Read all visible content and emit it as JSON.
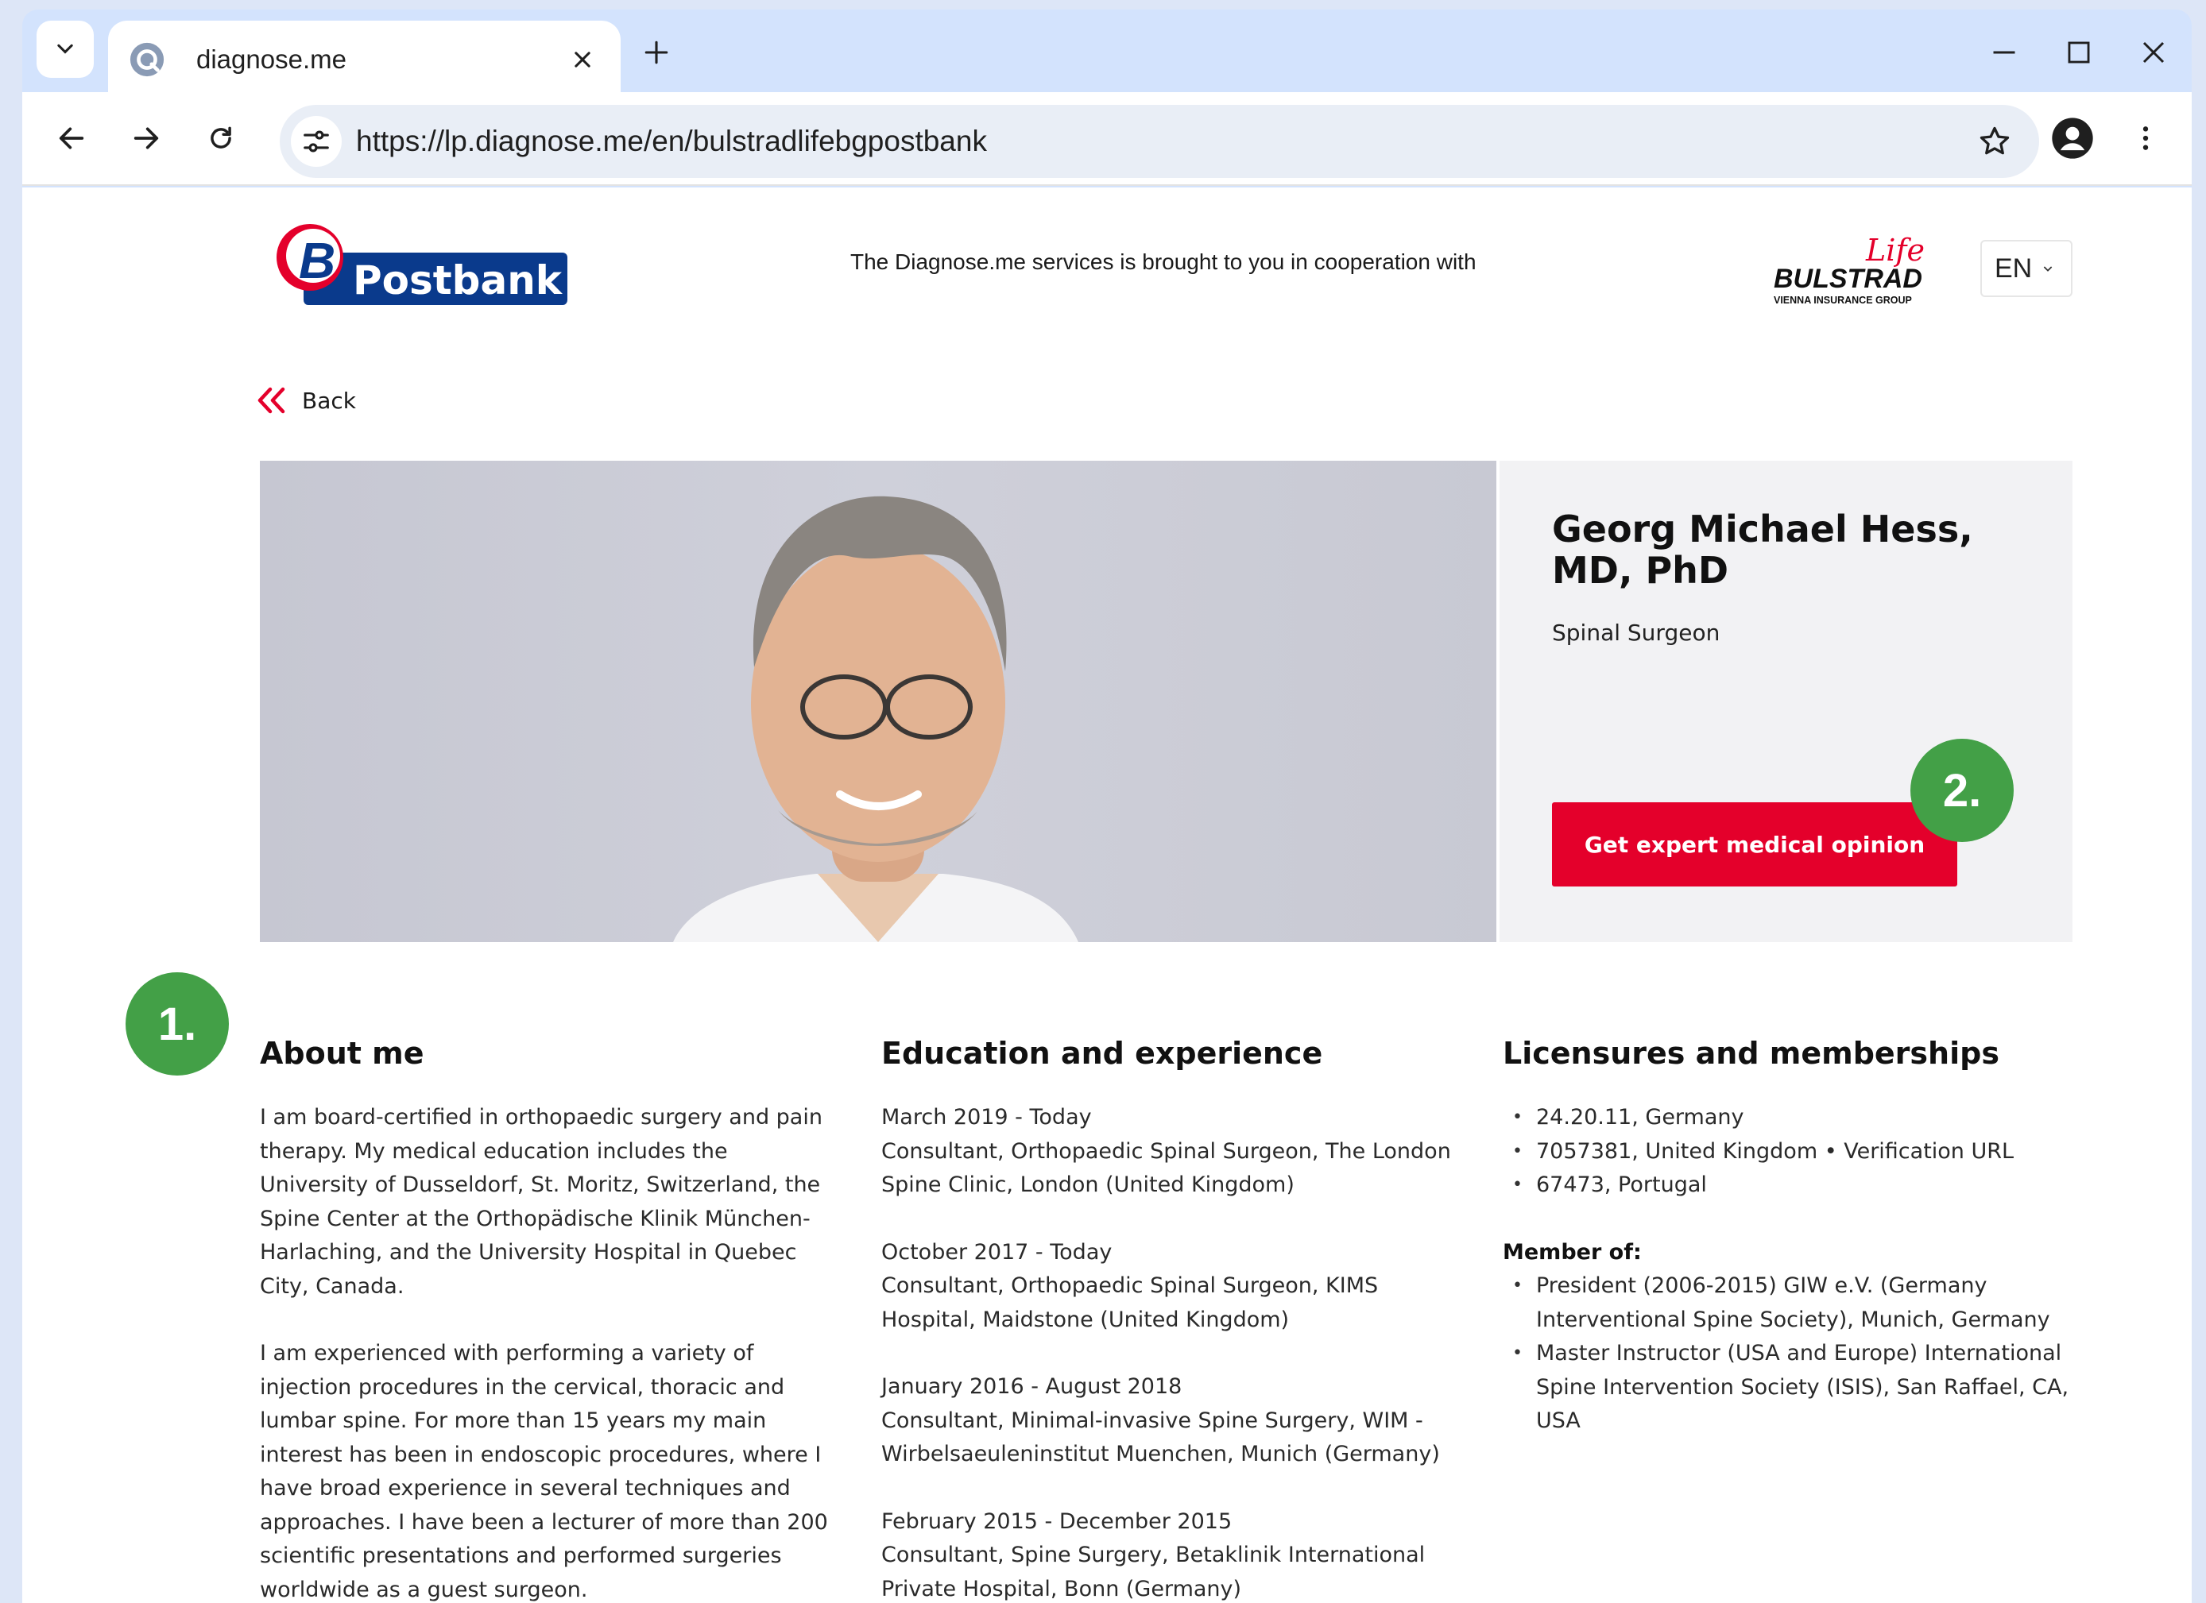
{
  "browser": {
    "tab_title": "diagnose.me",
    "url": "https://lp.diagnose.me/en/bulstradlifebgpostbank"
  },
  "header": {
    "partner_logo": "Postbank",
    "coop_text": "The Diagnose.me services is brought to you in cooperation with",
    "insurer_logo_main": "BULSTRAD",
    "insurer_logo_script": "Life",
    "insurer_logo_sub": "VIENNA INSURANCE GROUP",
    "language": "EN"
  },
  "back_label": "Back",
  "doctor": {
    "name": "Georg Michael Hess, MD, PhD",
    "specialty": "Spinal Surgeon",
    "cta_label": "Get expert medical opinion"
  },
  "badges": {
    "one": "1.",
    "two": "2."
  },
  "about": {
    "heading": "About me",
    "paragraphs": [
      "I am board-certified in orthopaedic surgery and pain therapy. My medical education includes the University of Dusseldorf, St. Moritz, Switzerland, the Spine Center at the Orthopädische Klinik München-Harlaching, and the University Hospital in Quebec City, Canada.",
      "I am experienced with performing a variety of injection procedures in the cervical, thoracic and lumbar spine. For more than 15 years my main interest has been in endoscopic procedures, where I have broad experience in several techniques and approaches. I have been a lecturer of more than 200 scientific presentations and performed surgeries worldwide as a guest surgeon."
    ]
  },
  "education": {
    "heading": "Education and experience",
    "items": [
      {
        "period": "March 2019 - Today",
        "description": "Consultant, Orthopaedic Spinal Surgeon, The London Spine Clinic, London (United Kingdom)"
      },
      {
        "period": "October 2017 - Today",
        "description": "Consultant, Orthopaedic Spinal Surgeon, KIMS Hospital, Maidstone (United Kingdom)"
      },
      {
        "period": "January 2016 - August 2018",
        "description": "Consultant, Minimal-invasive Spine Surgery, WIM - Wirbelsaeuleninstitut Muenchen, Munich (Germany)"
      },
      {
        "period": "February 2015 - December 2015",
        "description": "Consultant, Spine Surgery, Betaklinik International Private Hospital, Bonn (Germany)"
      }
    ]
  },
  "licensures": {
    "heading": "Licensures and memberships",
    "licenses": [
      "24.20.11, Germany",
      "7057381, United Kingdom • Verification URL",
      "67473, Portugal"
    ],
    "member_of_label": "Member of:",
    "memberships": [
      "President (2006-2015) GIW e.V. (Germany Interventional Spine Society), Munich, Germany",
      "Master Instructor (USA and Europe) International Spine Intervention Society (ISIS), San Raffael, CA, USA"
    ]
  },
  "colors": {
    "accent_red": "#e4002b",
    "badge_green": "#43a047",
    "postbank_blue": "#0a3a8c",
    "chrome_blue": "#d3e3fd"
  },
  "icons": [
    "tab-search-icon",
    "favicon-icon",
    "close-icon",
    "plus-icon",
    "minimize-icon",
    "maximize-icon",
    "back-arrow-icon",
    "forward-arrow-icon",
    "reload-icon",
    "site-settings-icon",
    "star-icon",
    "profile-icon",
    "more-vert-icon",
    "double-chevron-left-icon",
    "chevron-down-icon"
  ]
}
